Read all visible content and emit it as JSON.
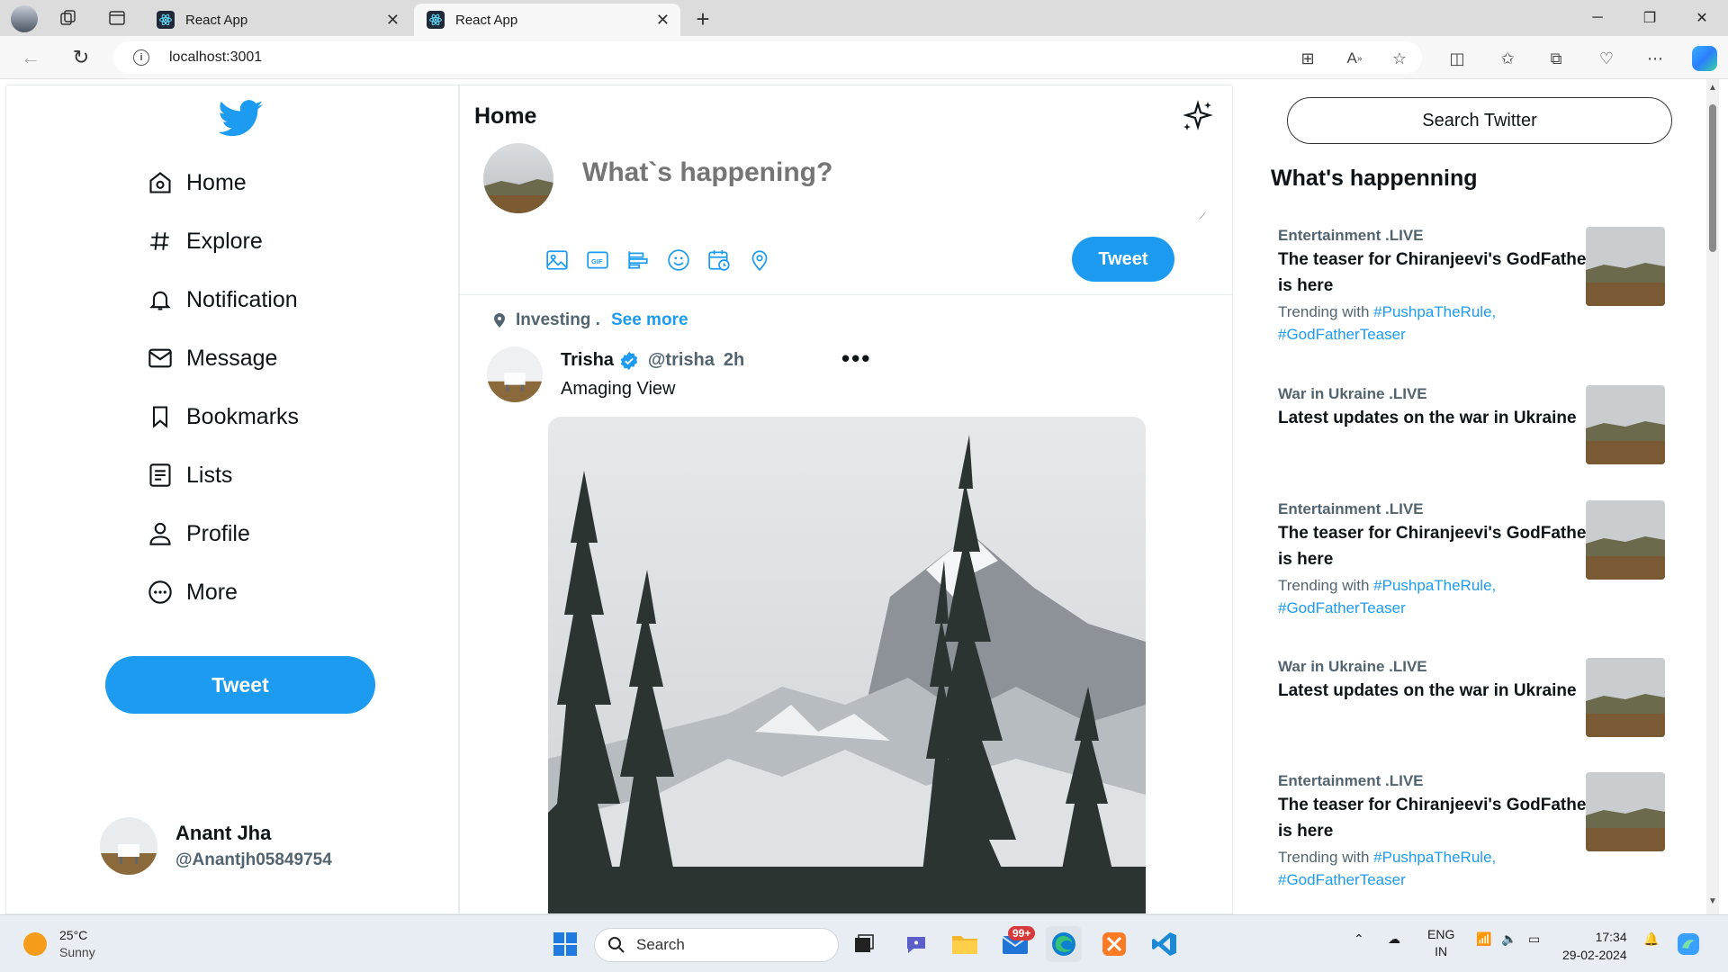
{
  "browser": {
    "tabs": [
      {
        "title": "React App",
        "active": false
      },
      {
        "title": "React App",
        "active": true
      }
    ],
    "url": "localhost:3001"
  },
  "sidebar": {
    "nav": [
      {
        "label": "Home",
        "icon": "home-icon"
      },
      {
        "label": "Explore",
        "icon": "hashtag-icon"
      },
      {
        "label": "Notification",
        "icon": "bell-icon"
      },
      {
        "label": "Message",
        "icon": "mail-icon"
      },
      {
        "label": "Bookmarks",
        "icon": "bookmark-icon"
      },
      {
        "label": "Lists",
        "icon": "list-icon"
      },
      {
        "label": "Profile",
        "icon": "user-icon"
      },
      {
        "label": "More",
        "icon": "more-circle-icon"
      }
    ],
    "tweet_label": "Tweet",
    "profile": {
      "name": "Anant Jha",
      "handle": "@Anantjh05849754"
    }
  },
  "feed": {
    "title": "Home",
    "composer": {
      "placeholder": "What`s happening?",
      "tweet_label": "Tweet"
    },
    "post": {
      "context": "Investing .",
      "see_more": "See more",
      "author": "Trisha",
      "handle": "@trisha",
      "time": "2h",
      "menu": "•••",
      "text": "Amaging View"
    }
  },
  "right": {
    "search_label": "Search Twitter",
    "trends_title": "What's happenning",
    "trends": [
      {
        "category": "Entertainment .LIVE",
        "headline": "The teaser for Chiranjeevi's GodFather is here",
        "trending_prefix": "Trending with ",
        "tag1": "#PushpaTheRule,",
        "tag2": "#GodFatherTeaser"
      },
      {
        "category": "War in Ukraine .LIVE",
        "headline": "Latest updates on the war in Ukraine"
      },
      {
        "category": "Entertainment .LIVE",
        "headline": "The teaser for Chiranjeevi's GodFather is here",
        "trending_prefix": "Trending with ",
        "tag1": "#PushpaTheRule,",
        "tag2": "#GodFatherTeaser"
      },
      {
        "category": "War in Ukraine .LIVE",
        "headline": "Latest updates on the war in Ukraine"
      },
      {
        "category": "Entertainment .LIVE",
        "headline": "The teaser for Chiranjeevi's GodFather is here",
        "trending_prefix": "Trending with ",
        "tag1": "#PushpaTheRule,",
        "tag2": "#GodFatherTeaser"
      }
    ]
  },
  "taskbar": {
    "weather_temp": "25°C",
    "weather_desc": "Sunny",
    "search_label": "Search",
    "mail_badge": "99+",
    "lang_line1": "ENG",
    "lang_line2": "IN",
    "time": "17:34",
    "date": "29-02-2024"
  },
  "colors": {
    "accent": "#1d9bf0",
    "text": "#0f1419",
    "muted": "#536471"
  }
}
